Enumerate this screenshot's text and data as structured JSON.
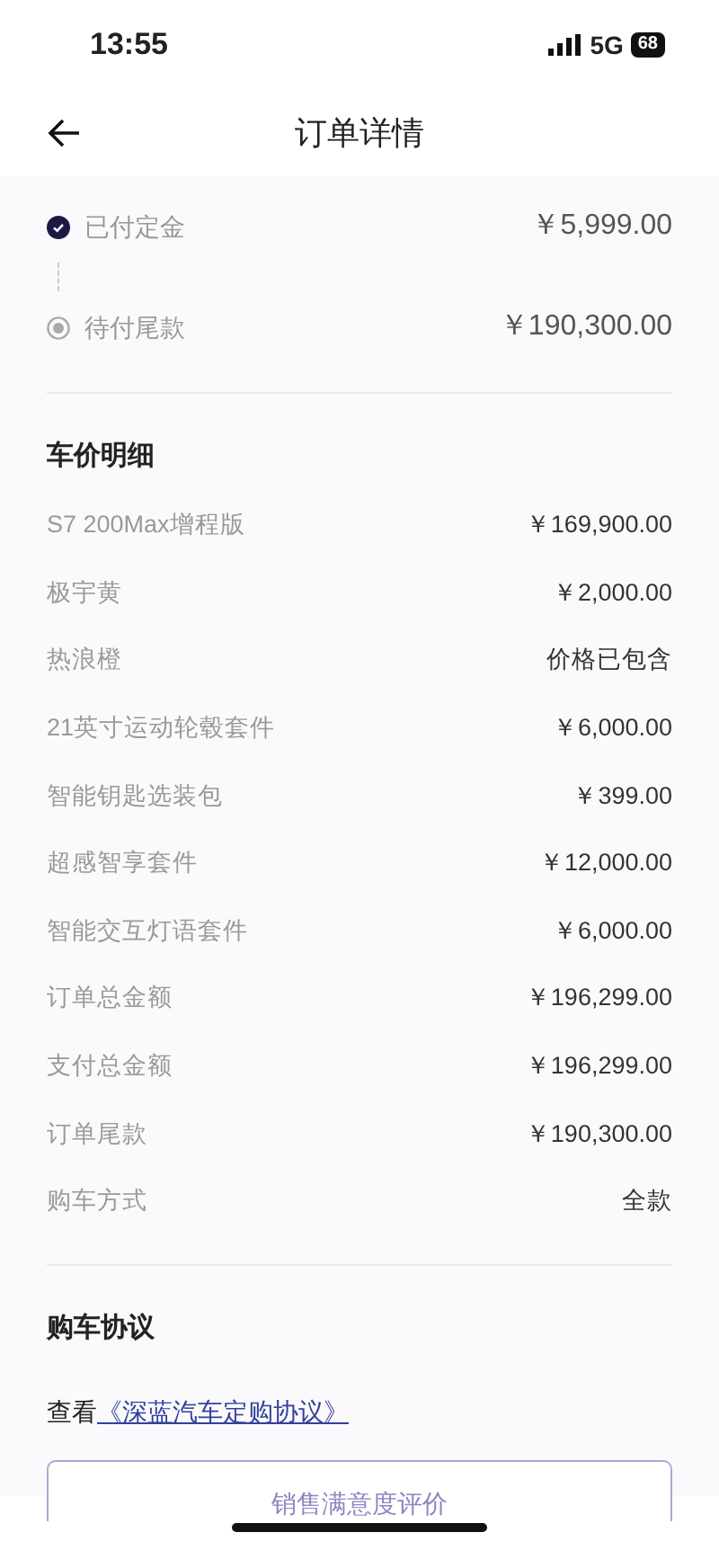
{
  "status_bar": {
    "time": "13:55",
    "network": "5G",
    "battery": "68"
  },
  "header": {
    "title": "订单详情"
  },
  "payments": [
    {
      "label": "已付定金",
      "amount": "￥5,999.00",
      "done": true
    },
    {
      "label": "待付尾款",
      "amount": "￥190,300.00",
      "done": false
    }
  ],
  "price_detail": {
    "title": "车价明细",
    "rows": [
      {
        "label": "S7 200Max增程版",
        "value": "￥169,900.00"
      },
      {
        "label": "极宇黄",
        "value": "￥2,000.00"
      },
      {
        "label": "热浪橙",
        "value": "价格已包含"
      },
      {
        "label": "21英寸运动轮毂套件",
        "value": "￥6,000.00"
      },
      {
        "label": "智能钥匙选装包",
        "value": "￥399.00"
      },
      {
        "label": "超感智享套件",
        "value": "￥12,000.00"
      },
      {
        "label": "智能交互灯语套件",
        "value": "￥6,000.00"
      },
      {
        "label": "订单总金额",
        "value": "￥196,299.00"
      },
      {
        "label": "支付总金额",
        "value": "￥196,299.00"
      },
      {
        "label": "订单尾款",
        "value": "￥190,300.00"
      },
      {
        "label": "购车方式",
        "value": "全款"
      }
    ]
  },
  "agreement": {
    "title": "购车协议",
    "prefix": "查看",
    "link": "《深蓝汽车定购协议》"
  },
  "button": "销售满意度评价"
}
